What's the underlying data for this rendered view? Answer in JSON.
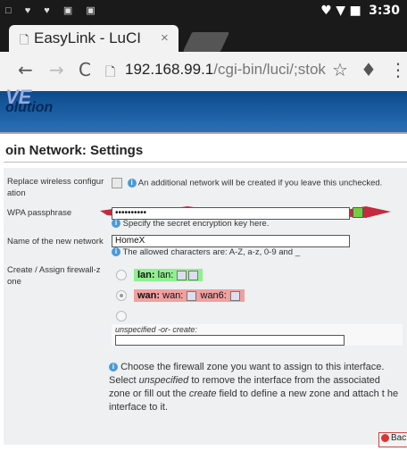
{
  "statusbar": {
    "time": "3:30",
    "left_icons": "□ ♥ ♥ ▣ ▣",
    "right_icons": "♥ ▼ ■"
  },
  "tab": {
    "title": "EasyLink - LuCI",
    "close": "×",
    "page_icon": "🗋"
  },
  "addressbar": {
    "back": "←",
    "forward": "→",
    "reload": "C",
    "url_host": "192.168.99.1",
    "url_path": "/cgi-bin/luci/;stok",
    "star": "☆",
    "mic": "♦",
    "menu": "⋮"
  },
  "header": {
    "logo_top": "VE",
    "logo_text": "olution"
  },
  "page": {
    "title": "oin Network: Settings"
  },
  "form": {
    "replace": {
      "label_line1": "Replace wireless configur",
      "label_line2": "ation",
      "help": "An additional network will be created if you leave this unchecked."
    },
    "wpa": {
      "label": "WPA passphrase",
      "value": "••••••••••",
      "help": "Specify the secret encryption key here."
    },
    "network_name": {
      "label": "Name of the new network",
      "value": "HomeX",
      "help": "The allowed characters are: A-Z, a-z, 0-9 and _"
    },
    "firewall": {
      "label_line1": "Create / Assign firewall-z",
      "label_line2": "one",
      "lan_zone": "lan:",
      "lan_net": "lan:",
      "wan_zone": "wan:",
      "wan_net": "wan:",
      "wan6_net": "wan6:",
      "create_label": "unspecified -or- create:",
      "help_prefix": "Choose the firewall zone you want to assign to this interface. Select ",
      "help_unspecified": "unspecified",
      "help_middle": " to remove the interface from the associated zone or fill out the ",
      "help_create": "create",
      "help_suffix": " field to define a new zone and attach t he interface to it."
    }
  },
  "footer": {
    "back_label": "Bac"
  },
  "colors": {
    "header_blue": "#0c4a8c",
    "lan_green": "#90f090",
    "wan_red": "#f0a0a0",
    "redact_red": "#c0142a"
  }
}
